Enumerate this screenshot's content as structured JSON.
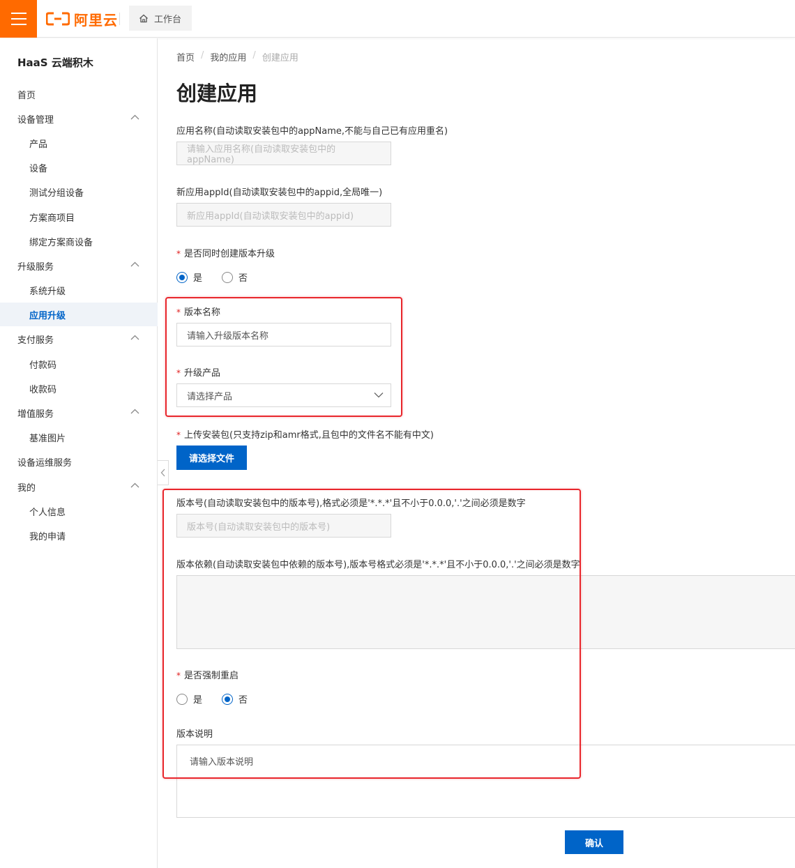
{
  "topbar": {
    "logo_text": "阿里云",
    "workbench_label": "工作台",
    "brand_color": "#ff6a00"
  },
  "sidebar": {
    "title": "HaaS 云端积木",
    "items": [
      {
        "label": "首页"
      },
      {
        "label": "设备管理"
      },
      {
        "label": "产品"
      },
      {
        "label": "设备"
      },
      {
        "label": "测试分组设备"
      },
      {
        "label": "方案商项目"
      },
      {
        "label": "绑定方案商设备"
      },
      {
        "label": "升级服务"
      },
      {
        "label": "系统升级"
      },
      {
        "label": "应用升级"
      },
      {
        "label": "支付服务"
      },
      {
        "label": "付款码"
      },
      {
        "label": "收款码"
      },
      {
        "label": "增值服务"
      },
      {
        "label": "基准图片"
      },
      {
        "label": "设备运维服务"
      },
      {
        "label": "我的"
      },
      {
        "label": "个人信息"
      },
      {
        "label": "我的申请"
      }
    ],
    "active_item": "应用升级"
  },
  "breadcrumb": [
    "首页",
    "我的应用",
    "创建应用"
  ],
  "page_title": "创建应用",
  "form": {
    "app_name_label": "应用名称(自动读取安装包中的appName,不能与自己已有应用重名)",
    "app_name_placeholder": "请输入应用名称(自动读取安装包中的appName)",
    "appid_label": "新应用appId(自动读取安装包中的appid,全局唯一)",
    "appid_placeholder": "新应用appId(自动读取安装包中的appid)",
    "create_upgrade_label": "是否同时创建版本升级",
    "yes": "是",
    "no": "否",
    "create_upgrade_value": "是",
    "version_name_label": "版本名称",
    "version_name_placeholder": "请输入升级版本名称",
    "upgrade_product_label": "升级产品",
    "upgrade_product_placeholder": "请选择产品",
    "upload_label": "上传安装包(只支持zip和amr格式,且包中的文件名不能有中文)",
    "upload_button": "请选择文件",
    "version_no_label": "版本号(自动读取安装包中的版本号),格式必须是'*.*.*'且不小于0.0.0,'.'之间必须是数字",
    "version_no_placeholder": "版本号(自动读取安装包中的版本号)",
    "dependency_label": "版本依赖(自动读取安装包中依赖的版本号),版本号格式必须是'*.*.*'且不小于0.0.0,'.'之间必须是数字",
    "force_restart_label": "是否强制重启",
    "force_restart_value": "否",
    "description_label": "版本说明",
    "description_placeholder": "请输入版本说明",
    "confirm_button": "确认"
  },
  "colors": {
    "primary": "#0064c8",
    "annotation_red": "#e8262c",
    "required_star": "#e02020"
  }
}
